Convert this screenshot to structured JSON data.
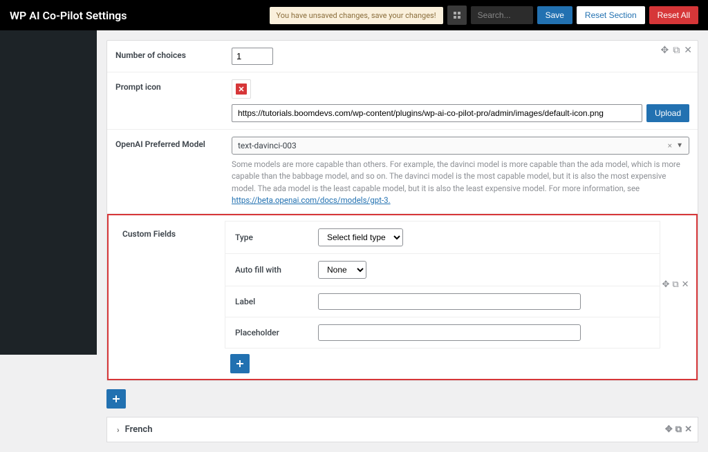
{
  "topbar": {
    "title": "WP AI Co-Pilot Settings",
    "unsaved": "You have unsaved changes, save your changes!",
    "search_placeholder": "Search...",
    "save": "Save",
    "reset_section": "Reset Section",
    "reset_all": "Reset All"
  },
  "rows": {
    "num_choices": {
      "label": "Number of choices",
      "value": "1"
    },
    "prompt_icon": {
      "label": "Prompt icon",
      "url": "https://tutorials.boomdevs.com/wp-content/plugins/wp-ai-co-pilot-pro/admin/images/default-icon.png",
      "upload": "Upload"
    },
    "model": {
      "label": "OpenAI Preferred Model",
      "value": "text-davinci-003",
      "help_prefix": "Some models are more capable than others. For example, the davinci model is more capable than the ada model, which is more capable than the babbage model, and so on. The davinci model is the most capable model, but it is also the most expensive model. The ada model is the least capable model, but it is also the least expensive model. For more information, see ",
      "help_link_text": "https://beta.openai.com/docs/models/gpt-3.",
      "help_link_href": "https://beta.openai.com/docs/models/gpt-3"
    }
  },
  "custom_fields": {
    "label": "Custom Fields",
    "fields": {
      "type": {
        "label": "Type",
        "placeholder": "Select field type"
      },
      "auto_fill": {
        "label": "Auto fill with",
        "value": "None"
      },
      "label_f": {
        "label": "Label"
      },
      "placeholder_f": {
        "label": "Placeholder"
      }
    }
  },
  "accordion": {
    "title": "French"
  }
}
